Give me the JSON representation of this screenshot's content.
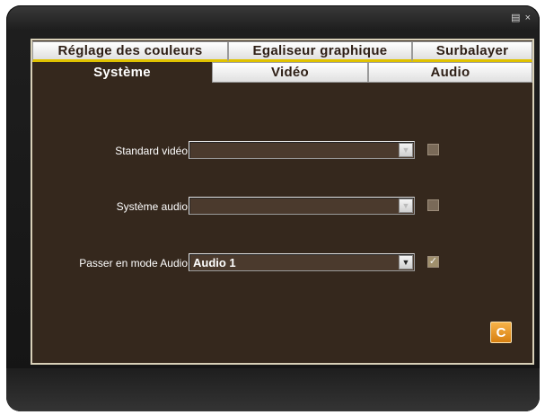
{
  "window": {
    "controls": {
      "menu_icon": "menu-icon",
      "close_label": "×"
    }
  },
  "tabs": {
    "top": [
      {
        "label": "Réglage des couleurs"
      },
      {
        "label": "Egaliseur graphique"
      },
      {
        "label": "Surbalayer"
      }
    ],
    "bottom": [
      {
        "label": "Système",
        "active": true
      },
      {
        "label": "Vidéo"
      },
      {
        "label": "Audio"
      }
    ]
  },
  "settings": {
    "video_standard": {
      "label": "Standard vidéo",
      "value": "",
      "enabled": false,
      "checked": false
    },
    "audio_system": {
      "label": "Système audio",
      "value": "",
      "enabled": false,
      "checked": false
    },
    "audio_mode": {
      "label": "Passer en mode Audio",
      "value": "Audio 1",
      "enabled": true,
      "checked": true
    }
  },
  "buttons": {
    "reset_icon": "refresh-icon",
    "reset_label": "C"
  },
  "colors": {
    "panel_bg": "#35281d",
    "tab_accent": "#e0c200",
    "reset_button": "#e8941f"
  }
}
